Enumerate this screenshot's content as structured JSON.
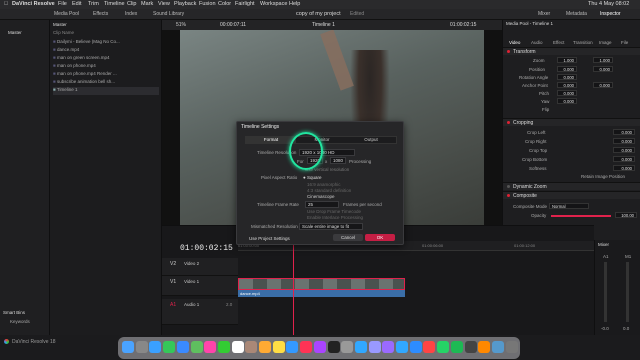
{
  "menubar": {
    "app": "DaVinci Resolve",
    "items": [
      "File",
      "Edit",
      "Trim",
      "Timeline",
      "Clip",
      "Mark",
      "View",
      "Playback",
      "Fusion",
      "Color",
      "Fairlight",
      "Workspace",
      "Help"
    ],
    "clock": "Thu 4 May 08:02"
  },
  "toolbar": {
    "media_pool": "Media Pool",
    "effects": "Effects",
    "index": "Index",
    "sound_library": "Sound Library",
    "project_title": "copy of my project",
    "edited": "Edited",
    "mixer": "Mixer",
    "metadata": "Metadata",
    "inspector": "Inspector"
  },
  "leftpanel": {
    "master": "Master",
    "smart_bins": "Smart Bins",
    "keywords": "Keywords"
  },
  "mediapool": {
    "header": "Master",
    "column": "Clip Name",
    "clips": [
      "Dailymi - Believe (Mag No Co...",
      "dance.mp4",
      "man on green screen.mp4",
      "man on phone.mp4",
      "man on phone.mp4 Render ...",
      "subscribe animation bell sh...",
      "Timeline 1"
    ]
  },
  "viewer": {
    "zoom": "51%",
    "src_timecode": "00:00:07:11",
    "timeline_name": "Timeline 1",
    "rec_timecode": "01:00:02:15"
  },
  "inspector": {
    "header": "Media Pool - Timeline 1",
    "tabs": [
      "Video",
      "Audio",
      "Effect",
      "Transition",
      "Image",
      "File"
    ],
    "transform": "Transform",
    "zoom": "Zoom",
    "zoom_x": "1.000",
    "zoom_y": "1.000",
    "position": "Position",
    "pos_x": "0.000",
    "pos_y": "0.000",
    "rotation": "Rotation Angle",
    "rotation_val": "0.000",
    "anchor": "Anchor Point",
    "anchor_x": "0.000",
    "anchor_y": "0.000",
    "pitch": "Pitch",
    "pitch_val": "0.000",
    "yaw": "Yaw",
    "yaw_val": "0.000",
    "flip": "Flip",
    "cropping": "Cropping",
    "crop_left": "Crop Left",
    "crop_right": "Crop Right",
    "crop_top": "Crop Top",
    "crop_bottom": "Crop Bottom",
    "softness": "Softness",
    "crop_vals": [
      "0.000",
      "0.000",
      "0.000",
      "0.000",
      "0.000"
    ],
    "retain_image_position": "Retain Image Position",
    "dynamic_zoom": "Dynamic Zoom",
    "composite": "Composite",
    "composite_mode": "Composite Mode",
    "composite_mode_val": "Normal",
    "opacity": "Opacity",
    "opacity_val": "100.00"
  },
  "dialog": {
    "title": "Timeline Settings",
    "tabs": [
      "Format",
      "Monitor",
      "Output"
    ],
    "timeline_resolution_label": "Timeline Resolution",
    "timeline_resolution_val": "1920 x 1080 HD",
    "for_label": "For",
    "width": "1920",
    "x_label": "x",
    "height": "1080",
    "processing": "Processing",
    "vertical_resolution": "Use vertical resolution",
    "pixel_aspect_label": "Pixel Aspect Ratio",
    "aspect_options": [
      "Square",
      "16:9 anamorphic",
      "4:3 standard definition",
      "Cinemascope"
    ],
    "frame_rate_label": "Timeline Frame Rate",
    "frame_rate_val": "25",
    "frames_per_second": "Frames per second",
    "drop_frame": "Use Drop Frame Timecode",
    "interlace": "Enable Interlace Processing",
    "mismatched_label": "Mismatched Resolution",
    "mismatched_val": "Scale entire image to fit",
    "use_project_settings": "Use Project Settings",
    "cancel": "Cancel",
    "ok": "OK"
  },
  "timeline": {
    "timecode": "01:00:02:15",
    "ruler": [
      "01:00:00:00",
      "01:00:06:00",
      "01:00:12:00"
    ],
    "tracks": [
      {
        "id": "V2",
        "name": "Video 2"
      },
      {
        "id": "V1",
        "name": "Video 1"
      },
      {
        "id": "A1",
        "name": "Audio 1",
        "gain": "2.0"
      }
    ],
    "clip_label": "dance.mp4"
  },
  "mixer": {
    "title": "Mixer",
    "ch1": "A1",
    "ch2": "M1",
    "vals": [
      "-0.0",
      "0.0"
    ]
  },
  "statusbar": {
    "app_version": "DaVinci Resolve 18"
  },
  "colors": {
    "accent": "#e0224c",
    "playhead": "#e0224c",
    "annotation": "#21e6a0",
    "clip_blue": "#3a6ea8"
  },
  "dock": {
    "icons": [
      "finder-icon",
      "launchpad-icon",
      "safari-icon",
      "messages-icon",
      "mail-icon",
      "maps-icon",
      "photos-icon",
      "facetime-icon",
      "calendar-icon",
      "contacts-icon",
      "reminders-icon",
      "notes-icon",
      "appstore-icon",
      "music-icon",
      "podcasts-icon",
      "tv-icon",
      "settings-icon",
      "photoshop-icon",
      "premiere-icon",
      "aftereffects-icon",
      "lightroom-icon",
      "zoom-icon",
      "chrome-icon",
      "whatsapp-icon",
      "spotify-icon",
      "resolve-icon",
      "vlc-icon",
      "folder-icon",
      "trash-icon"
    ]
  }
}
